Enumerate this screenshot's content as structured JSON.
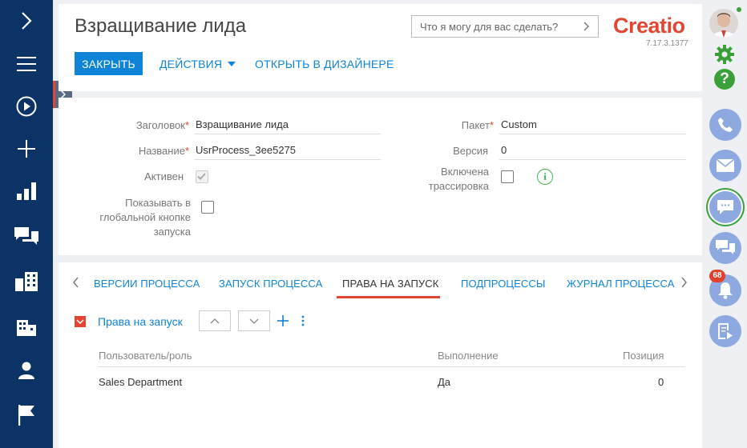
{
  "page": {
    "title": "Взращивание лида",
    "search_placeholder": "Что я могу для вас сделать?",
    "logo_text": "Creatio",
    "version": "7.17.3.1377"
  },
  "toolbar": {
    "close_label": "ЗАКРЫТЬ",
    "actions_label": "ДЕЙСТВИЯ",
    "designer_label": "ОТКРЫТЬ В ДИЗАЙНЕРЕ"
  },
  "left_nav": {
    "items": [
      "expand-icon",
      "menu-icon",
      "play-icon",
      "plus-icon",
      "dashboard-icon",
      "communication-icon",
      "accounts-icon",
      "buildings-icon",
      "contact-icon",
      "flag-icon"
    ]
  },
  "right_panel": {
    "notification_count": "68",
    "accent_green": "#3aa13a",
    "circle_color": "#8ea9df"
  },
  "fields": {
    "caption_label": "Заголовок",
    "caption_value": "Взращивание лида",
    "name_label": "Название",
    "name_value": "UsrProcess_3ee5275",
    "active_label": "Активен",
    "active_checked": true,
    "global_run_label": "Показывать в глобальной кнопке запуска",
    "global_run_checked": false,
    "package_label": "Пакет",
    "package_value": "Custom",
    "version_label": "Версия",
    "version_value": "0",
    "tracing_label": "Включена трассировка",
    "tracing_checked": false,
    "required_mark": "*"
  },
  "tabs": [
    {
      "label": "ВЕРСИИ ПРОЦЕССА",
      "active": false
    },
    {
      "label": "ЗАПУСК ПРОЦЕССА",
      "active": false
    },
    {
      "label": "ПРАВА НА ЗАПУСК",
      "active": true
    },
    {
      "label": "ПОДПРОЦЕССЫ",
      "active": false
    },
    {
      "label": "ЖУРНАЛ ПРОЦЕССА",
      "active": false
    }
  ],
  "detail": {
    "title": "Права на запуск",
    "columns": [
      "Пользователь/роль",
      "Выполнение",
      "Позиция"
    ],
    "rows": [
      {
        "user": "Sales Department",
        "execution": "Да",
        "position": "0"
      }
    ]
  },
  "colors": {
    "nav_bg": "#0c3366",
    "primary": "#0e84d8",
    "accent_red": "#e44533"
  }
}
